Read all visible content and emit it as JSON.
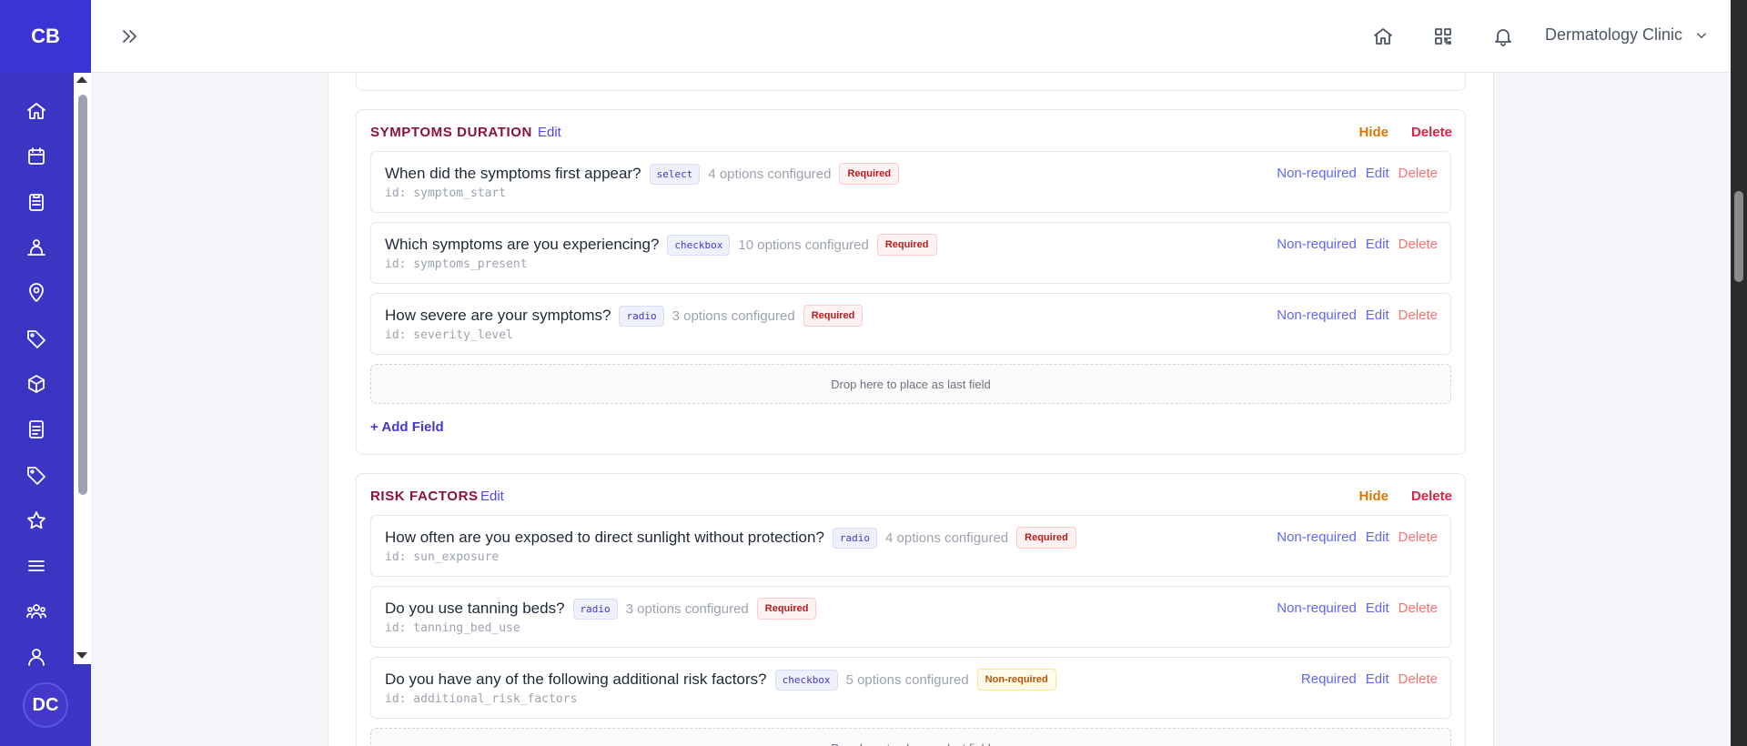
{
  "rail": {
    "logo": "CB",
    "avatar_initials": "DC",
    "items": [
      {
        "name": "home-icon"
      },
      {
        "name": "calendar-icon"
      },
      {
        "name": "clipboard-icon"
      },
      {
        "name": "users-hierarchy-icon"
      },
      {
        "name": "location-pin-icon"
      },
      {
        "name": "tag-icon"
      },
      {
        "name": "cube-icon"
      },
      {
        "name": "document-icon"
      },
      {
        "name": "tag-alt-icon"
      },
      {
        "name": "star-icon"
      },
      {
        "name": "menu-lines-icon"
      },
      {
        "name": "team-icon"
      },
      {
        "name": "user-icon"
      }
    ]
  },
  "topbar": {
    "clinic_name": "Dermatology Clinic"
  },
  "sections": [
    {
      "title": "SYMPTOMS DURATION",
      "edit_label": "Edit",
      "hide_label": "Hide",
      "delete_label": "Delete",
      "dropzone_text": "Drop here to place as last field",
      "add_field_label": "+ Add Field",
      "fields": [
        {
          "question": "When did the symptoms first appear?",
          "type": "select",
          "options": "4 options configured",
          "required_badge": "Required",
          "id": "id: symptom_start",
          "toggle": "Non-required",
          "edit": "Edit",
          "delete": "Delete"
        },
        {
          "question": "Which symptoms are you experiencing?",
          "type": "checkbox",
          "options": "10 options configured",
          "required_badge": "Required",
          "id": "id: symptoms_present",
          "toggle": "Non-required",
          "edit": "Edit",
          "delete": "Delete"
        },
        {
          "question": "How severe are your symptoms?",
          "type": "radio",
          "options": "3 options configured",
          "required_badge": "Required",
          "id": "id: severity_level",
          "toggle": "Non-required",
          "edit": "Edit",
          "delete": "Delete"
        }
      ]
    },
    {
      "title": "RISK FACTORS",
      "edit_label": "Edit",
      "hide_label": "Hide",
      "delete_label": "Delete",
      "dropzone_text": "Drop here to place as last field",
      "fields": [
        {
          "question": "How often are you exposed to direct sunlight without protection?",
          "type": "radio",
          "options": "4 options configured",
          "required_badge": "Required",
          "id": "id: sun_exposure",
          "toggle": "Non-required",
          "edit": "Edit",
          "delete": "Delete"
        },
        {
          "question": "Do you use tanning beds?",
          "type": "radio",
          "options": "3 options configured",
          "required_badge": "Required",
          "id": "id: tanning_bed_use",
          "toggle": "Non-required",
          "edit": "Edit",
          "delete": "Delete"
        },
        {
          "question": "Do you have any of the following additional risk factors?",
          "type": "checkbox",
          "options": "5 options configured",
          "required_badge": "Non-required",
          "id": "id: additional_risk_factors",
          "toggle": "Required",
          "edit": "Edit",
          "delete": "Delete"
        }
      ]
    }
  ]
}
